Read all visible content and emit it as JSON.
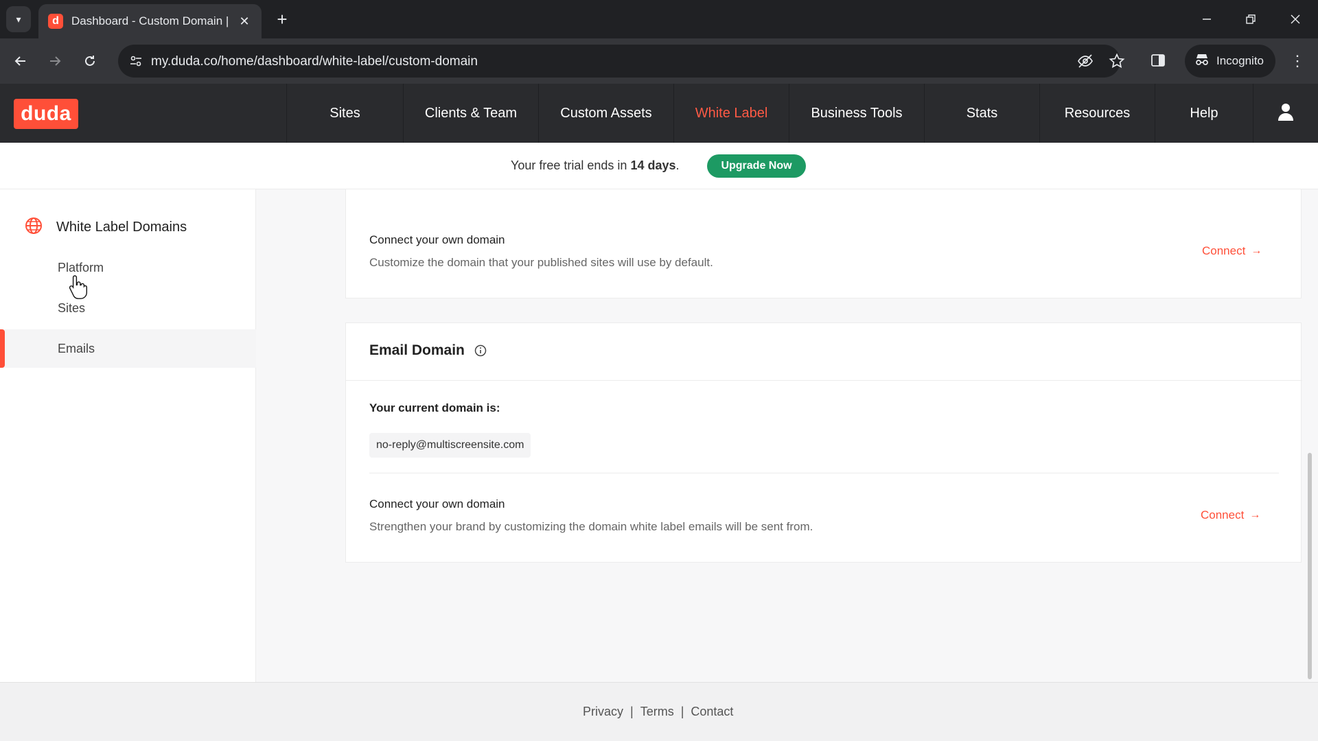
{
  "browser": {
    "tab_title": "Dashboard - Custom Domain |",
    "favicon_letter": "d",
    "url": "my.duda.co/home/dashboard/white-label/custom-domain",
    "incognito_label": "Incognito"
  },
  "app": {
    "logo_text": "duda",
    "nav": [
      {
        "label": "Sites"
      },
      {
        "label": "Clients & Team"
      },
      {
        "label": "Custom Assets"
      },
      {
        "label": "White Label",
        "active": true
      },
      {
        "label": "Business Tools"
      },
      {
        "label": "Stats"
      },
      {
        "label": "Resources"
      },
      {
        "label": "Help"
      }
    ],
    "accent": "#ff4f38"
  },
  "banner": {
    "text_before": "Your free trial ends in ",
    "days": "14 days",
    "text_after": ".",
    "upgrade_label": "Upgrade Now"
  },
  "sidebar": {
    "heading": "White Label Domains",
    "items": [
      {
        "label": "Platform"
      },
      {
        "label": "Sites"
      },
      {
        "label": "Emails",
        "active": true
      }
    ]
  },
  "main": {
    "site_domain_card": {
      "title": "Connect your own domain",
      "subtitle": "Customize the domain that your published sites will use by default.",
      "connect_label": "Connect"
    },
    "email_domain": {
      "section_title": "Email Domain",
      "current_label": "Your current domain is:",
      "current_value": "no-reply@multiscreensite.com",
      "connect_title": "Connect your own domain",
      "connect_subtitle": "Strengthen your brand by customizing the domain white label emails will be sent from.",
      "connect_label": "Connect"
    }
  },
  "footer": {
    "privacy": "Privacy",
    "terms": "Terms",
    "contact": "Contact",
    "separator": "|"
  }
}
